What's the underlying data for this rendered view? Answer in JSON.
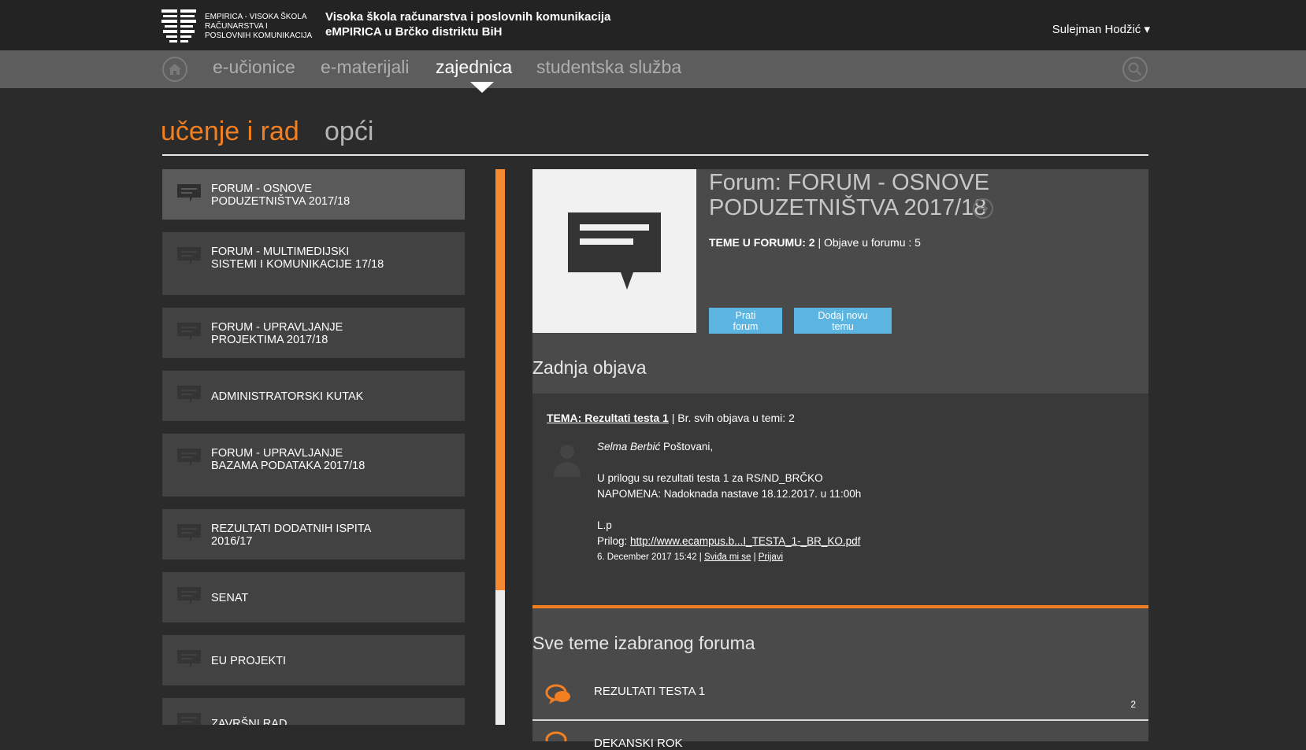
{
  "header": {
    "logo_text": "eMPIRICA - Visoka škola računarstva i poslovnih komunikacija",
    "school_line1": "Visoka škola računarstva i poslovnih komunikacija",
    "school_line2": "eMPIRICA u Brčko distriktu BiH",
    "user": "Sulejman Hodžić ▾"
  },
  "nav": {
    "items": [
      {
        "label": "e-učionice"
      },
      {
        "label": "e-materijali"
      },
      {
        "label": "zajednica"
      },
      {
        "label": "studentska služba"
      }
    ],
    "active": "zajednica",
    "home_icon": "home-icon",
    "search_icon": "search-icon"
  },
  "sections": {
    "tabs": [
      {
        "label": "učenje i rad"
      },
      {
        "label": "opći"
      }
    ],
    "active": "učenje i rad"
  },
  "forums": [
    {
      "title": "FORUM - OSNOVE PODUZETNIŠTVA 2017/18"
    },
    {
      "title": "FORUM - MULTIMEDIJSKI SISTEMI I KOMUNIKACIJE 17/18"
    },
    {
      "title": "FORUM - UPRAVLJANJE PROJEKTIMA 2017/18"
    },
    {
      "title": "ADMINISTRATORSKI KUTAK"
    },
    {
      "title": "FORUM - UPRAVLJANJE BAZAMA PODATAKA 2017/18"
    },
    {
      "title": "REZULTATI DODATNIH ISPITA 2016/17"
    },
    {
      "title": "SENAT"
    },
    {
      "title": "EU PROJEKTI"
    },
    {
      "title": "ZAVRŠNI RAD"
    }
  ],
  "detail": {
    "title": "Forum: FORUM - OSNOVE PODUZETNIŠTVA 2017/18",
    "topics_label": "TEME U FORUMU: 2",
    "posts_label": " | Objave u forumu : 5",
    "follow_button": "Prati forum",
    "add_topic_button": "Dodaj novu temu",
    "last_post_heading": "Zadnja objava",
    "all_topics_heading": "Sve teme izabranog foruma"
  },
  "last_post": {
    "topic_link": "TEMA: Rezultati testa 1",
    "topic_count": " | Br. svih objava u temi: 2",
    "author": "Selma Berbić",
    "greeting": " Poštovani,",
    "line1": "U prilogu su rezultati testa 1 za RS/ND_BRČKO",
    "line2": "NAPOMENA: Nadoknada nastave 18.12.2017. u 11:00h",
    "line3": "L.p",
    "attachment_label": "Prilog: ",
    "attachment_link": "http://www.ecampus.b...I_TESTA_1-_BR_KO.pdf",
    "date": "6. December 2017 15:42 | ",
    "like": "Sviđa mi se",
    "sep": " | ",
    "report": "Prijavi"
  },
  "topics": [
    {
      "title": "REZULTATI TESTA 1",
      "count": "2"
    },
    {
      "title": "DEKANSKI ROK"
    }
  ],
  "colors": {
    "accent": "#f47f20",
    "button": "#5bb5e0",
    "background": "#2b2b2b",
    "navbar": "#5d5d5d"
  }
}
